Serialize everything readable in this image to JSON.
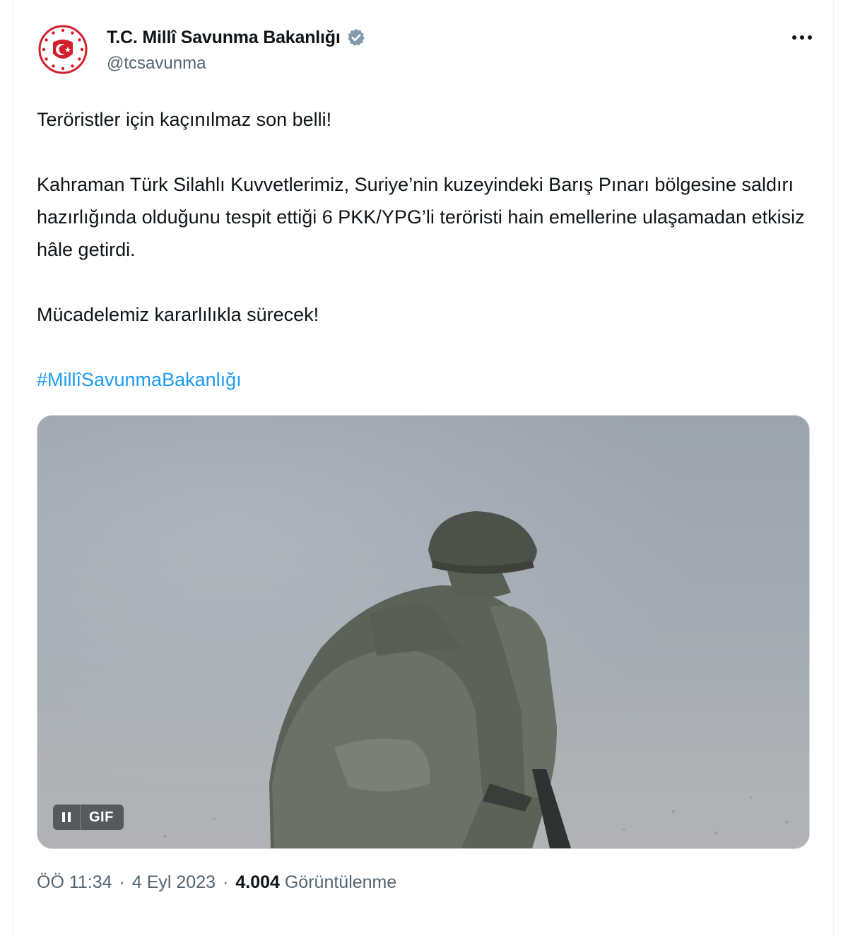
{
  "account": {
    "display_name": "T.C. Millî Savunma Bakanlığı",
    "handle": "@tcsavunma",
    "verified": true,
    "verified_color": "#829aab"
  },
  "tweet": {
    "paragraphs": [
      "Teröristler için kaçınılmaz son belli!",
      "Kahraman Türk Silahlı Kuvvetlerimiz, Suriye’nin kuzeyindeki Barış Pınarı bölgesine saldırı hazırlığında olduğunu tespit ettiği 6 PKK/YPG’li teröristi hain emellerine ulaşamadan etkisiz hâle getirdi.",
      "Mücadelemiz kararlılıkla sürecek!"
    ],
    "hashtag": "#MillîSavunmaBakanlığı"
  },
  "media": {
    "type": "gif",
    "gif_label": "GIF",
    "pause_icon": "pause-icon"
  },
  "meta": {
    "time": "ÖÖ 11:34",
    "date": "4 Eyl 2023",
    "separator": "·",
    "views_count": "4.004",
    "views_label": "Görüntülenme"
  },
  "colors": {
    "link": "#1d9bf0",
    "secondary_text": "#536471",
    "logo_red": "#d21f2b"
  },
  "icons": {
    "more": "more-icon",
    "verified": "verified-badge-icon",
    "avatar": "ministry-emblem-icon"
  }
}
